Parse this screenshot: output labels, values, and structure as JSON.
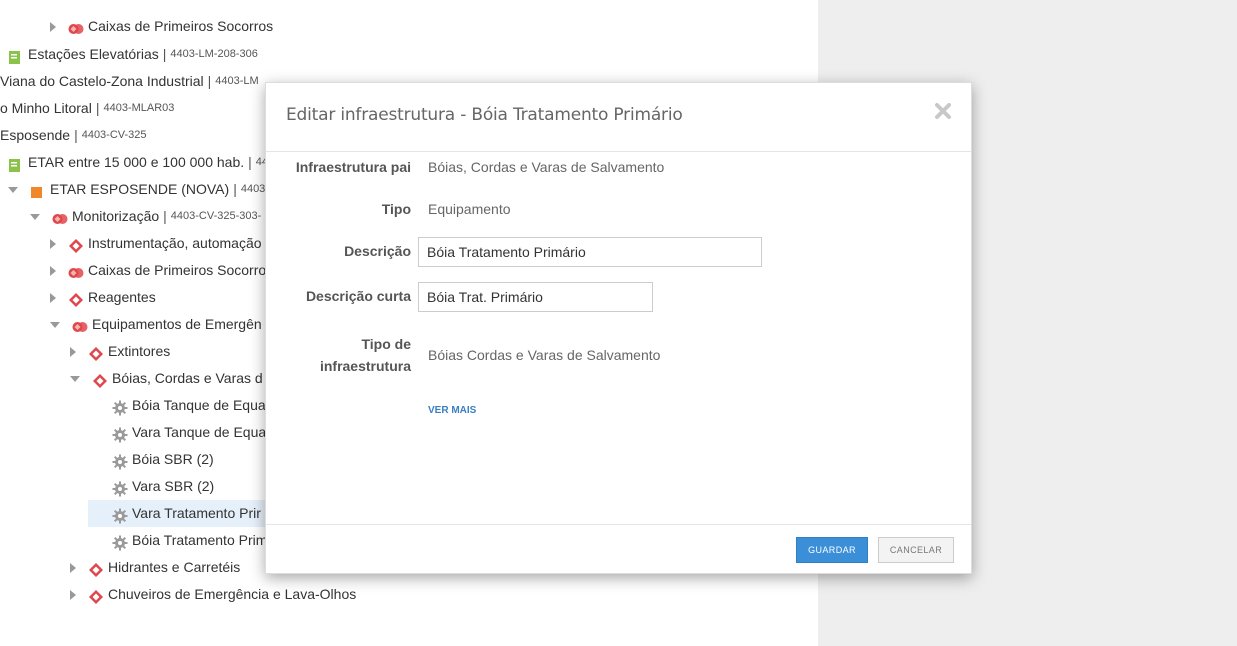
{
  "tree": {
    "rows": [
      {
        "label": "Caixas de Primeiros Socorros",
        "code": "",
        "icon": "equipment-group-icon",
        "arrow": "right"
      },
      {
        "label": "Estações Elevatórias",
        "code": "4403-LM-208-306",
        "icon": "folder-green-icon",
        "arrow": ""
      },
      {
        "label": "Viana do Castelo-Zona Industrial",
        "code": "4403-LM",
        "icon": "",
        "arrow": ""
      },
      {
        "label": "o Minho Litoral",
        "code": "4403-MLAR03",
        "icon": "",
        "arrow": ""
      },
      {
        "label": "Esposende",
        "code": "4403-CV-325",
        "icon": "",
        "arrow": ""
      },
      {
        "label": "ETAR entre 15 000 e 100 000 hab.",
        "code": "44",
        "icon": "folder-green-icon",
        "arrow": ""
      },
      {
        "label": "ETAR ESPOSENDE (NOVA)",
        "code": "4403",
        "icon": "facility-orange-icon",
        "arrow": "down"
      },
      {
        "label": "Monitorização",
        "code": "4403-CV-325-303-",
        "icon": "equipment-group-icon",
        "arrow": "down"
      },
      {
        "label": "Instrumentação, automação",
        "code": "",
        "icon": "equipment-icon",
        "arrow": "right"
      },
      {
        "label": "Caixas de Primeiros Socorro",
        "code": "",
        "icon": "equipment-group-icon",
        "arrow": "right"
      },
      {
        "label": "Reagentes",
        "code": "",
        "icon": "equipment-icon",
        "arrow": "right"
      },
      {
        "label": "Equipamentos de Emergên",
        "code": "",
        "icon": "equipment-group-icon",
        "arrow": "down"
      },
      {
        "label": "Extintores",
        "code": "",
        "icon": "equipment-icon",
        "arrow": "right"
      },
      {
        "label": "Bóias, Cordas e Varas d",
        "code": "",
        "icon": "equipment-icon",
        "arrow": "down"
      },
      {
        "label": "Bóia Tanque de Equa",
        "code": "",
        "icon": "gear-icon",
        "arrow": ""
      },
      {
        "label": "Vara Tanque de Equa",
        "code": "",
        "icon": "gear-icon",
        "arrow": ""
      },
      {
        "label": "Bóia SBR (2)",
        "code": "",
        "icon": "gear-icon",
        "arrow": ""
      },
      {
        "label": "Vara SBR (2)",
        "code": "",
        "icon": "gear-icon",
        "arrow": ""
      },
      {
        "label": "Vara Tratamento Prir",
        "code": "",
        "icon": "gear-icon",
        "arrow": "",
        "selected": true
      },
      {
        "label": "Bóia Tratamento Primário",
        "code": "",
        "icon": "gear-icon",
        "arrow": ""
      },
      {
        "label": "Hidrantes e Carretéis",
        "code": "",
        "icon": "equipment-icon",
        "arrow": "right"
      },
      {
        "label": "Chuveiros de Emergência e Lava-Olhos",
        "code": "",
        "icon": "equipment-icon",
        "arrow": "right"
      }
    ]
  },
  "modal": {
    "title": "Editar infraestrutura - Bóia Tratamento Primário",
    "fields": {
      "parent_label": "Infraestrutura pai",
      "parent_value": "Bóias, Cordas e Varas de Salvamento",
      "type_label": "Tipo",
      "type_value": "Equipamento",
      "description_label": "Descrição",
      "description_value": "Bóia Tratamento Primário",
      "short_description_label": "Descrição curta",
      "short_description_value": "Bóia Trat. Primário",
      "infra_type_label_1": "Tipo de",
      "infra_type_label_2": "infraestrutura",
      "infra_type_value": "Bóias Cordas e Varas de Salvamento"
    },
    "more_link": "VER MAIS",
    "save_label": "GUARDAR",
    "cancel_label": "CANCELAR"
  },
  "colors": {
    "accent": "#3b8fd9",
    "equipment_red": "#e0464a",
    "folder_green": "#8bc34a",
    "facility_orange": "#f0882a",
    "gear_gray": "#9a9a9a",
    "selected_bg": "#e6f0fa"
  }
}
